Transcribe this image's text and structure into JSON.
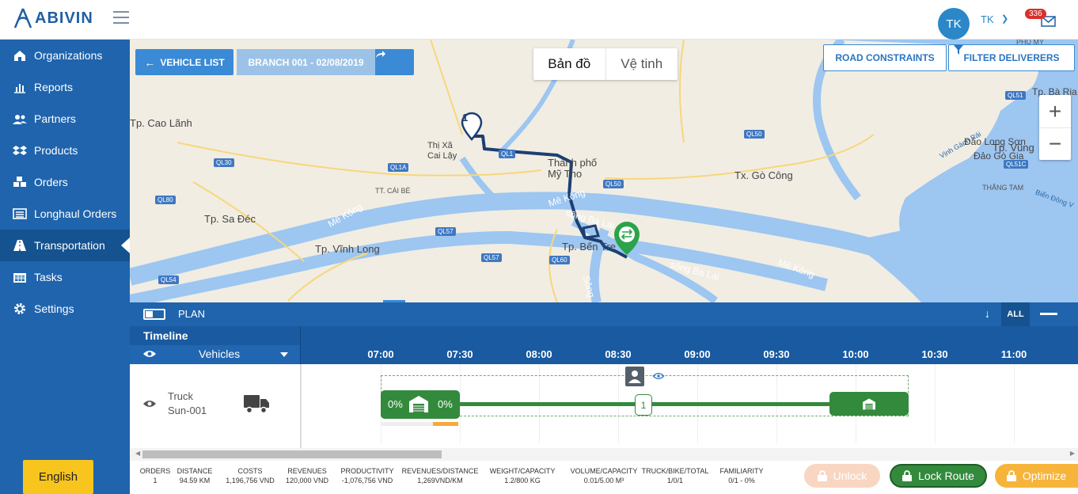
{
  "app": {
    "logo_text": "ABIVIN",
    "brand_color": "#1f64ad"
  },
  "user": {
    "initials": "TK",
    "name": "TK",
    "mail_count": "336"
  },
  "sidebar": {
    "items": [
      {
        "label": "Organizations",
        "icon": "home-icon"
      },
      {
        "label": "Reports",
        "icon": "bar-chart-icon"
      },
      {
        "label": "Partners",
        "icon": "users-icon"
      },
      {
        "label": "Products",
        "icon": "dropbox-icon"
      },
      {
        "label": "Orders",
        "icon": "cubes-icon"
      },
      {
        "label": "Longhaul Orders",
        "icon": "list-icon"
      },
      {
        "label": "Transportation",
        "icon": "road-icon",
        "active": true
      },
      {
        "label": "Tasks",
        "icon": "calendar-icon"
      },
      {
        "label": "Settings",
        "icon": "gear-icon"
      }
    ],
    "language": "English"
  },
  "map": {
    "vehicle_list": "VEHICLE LIST",
    "branch": "BRANCH 001 - 02/08/2019",
    "map_type_map": "Bản đồ",
    "map_type_satellite": "Vệ tinh",
    "road_constraints": "ROAD CONSTRAINTS",
    "filter_deliverers": "FILTER DELIVERERS",
    "stop_marker": "1",
    "labels": {
      "cao_lanh": "Tp. Cao Lãnh",
      "cai_lay": "Thị Xã\nCai Lậy",
      "my_tho": "Thành phố\nMỹ Tho",
      "go_cong": "Tx. Gò Công",
      "sa_dec": "Tp. Sa Đéc",
      "vinh_long": "Tp. Vĩnh Long",
      "ben_tre": "Tp. Bến Tre",
      "cai_be": "TT. CÁI BÈ",
      "long_son": "Đảo Long Sơn",
      "go_gia": "Đảo Gò Gia",
      "vung_tau": "Tp. Vũng",
      "ba_ria": "Tp. Bà Rịa",
      "thang_tam": "THẮNG TAM",
      "phu_my": "PHÚ MỸ",
      "vinh_ganh_rai": "Vịnh Gành Rái",
      "bien_dong": "Biển Đông V",
      "me_kong_1": "Mê Kông",
      "me_kong_2": "Mê Kông",
      "me_kong_3": "Mê Kông",
      "song_ba_lai_1": "sông Ba Lai",
      "song_ba_lai_2": "sông Ba Lai",
      "song_hau": "Sông"
    },
    "roads": [
      "QL30",
      "QL1A",
      "QL1",
      "QL50",
      "QL80",
      "QL57",
      "QL60",
      "QL54",
      "QL57",
      "QL50",
      "QL51",
      "QL51C"
    ]
  },
  "plan": {
    "title": "PLAN",
    "all": "ALL",
    "timeline": "Timeline",
    "vehicles": "Vehicles",
    "times": [
      "07:00",
      "07:30",
      "08:00",
      "08:30",
      "09:00",
      "09:30",
      "10:00",
      "10:30",
      "11:00"
    ],
    "truck_label": "Truck",
    "truck_id": "Sun-001",
    "start_pct_left": "0%",
    "start_pct_right": "0%",
    "stop_number": "1"
  },
  "stats": [
    {
      "label": "ORDERS",
      "value": "1"
    },
    {
      "label": "DISTANCE",
      "value": "94.59 KM"
    },
    {
      "label": "COSTS",
      "value": "1,196,756 VND"
    },
    {
      "label": "REVENUES",
      "value": "120,000 VND"
    },
    {
      "label": "PRODUCTIVITY",
      "value": "-1,076,756 VND"
    },
    {
      "label": "REVENUES/DISTANCE",
      "value": "1,269VND/KM"
    },
    {
      "label": "WEIGHT/CAPACITY",
      "value": "1.2/800 KG"
    },
    {
      "label": "VOLUME/CAPACITY",
      "value": "0.01/5.00 M³"
    },
    {
      "label": "TRUCK/BIKE/TOTAL",
      "value": "1/0/1"
    },
    {
      "label": "FAMILIARITY",
      "value": "0/1 - 0%"
    }
  ],
  "actions": {
    "unlock": "Unlock",
    "lock_route": "Lock Route",
    "optimize": "Optimize"
  }
}
